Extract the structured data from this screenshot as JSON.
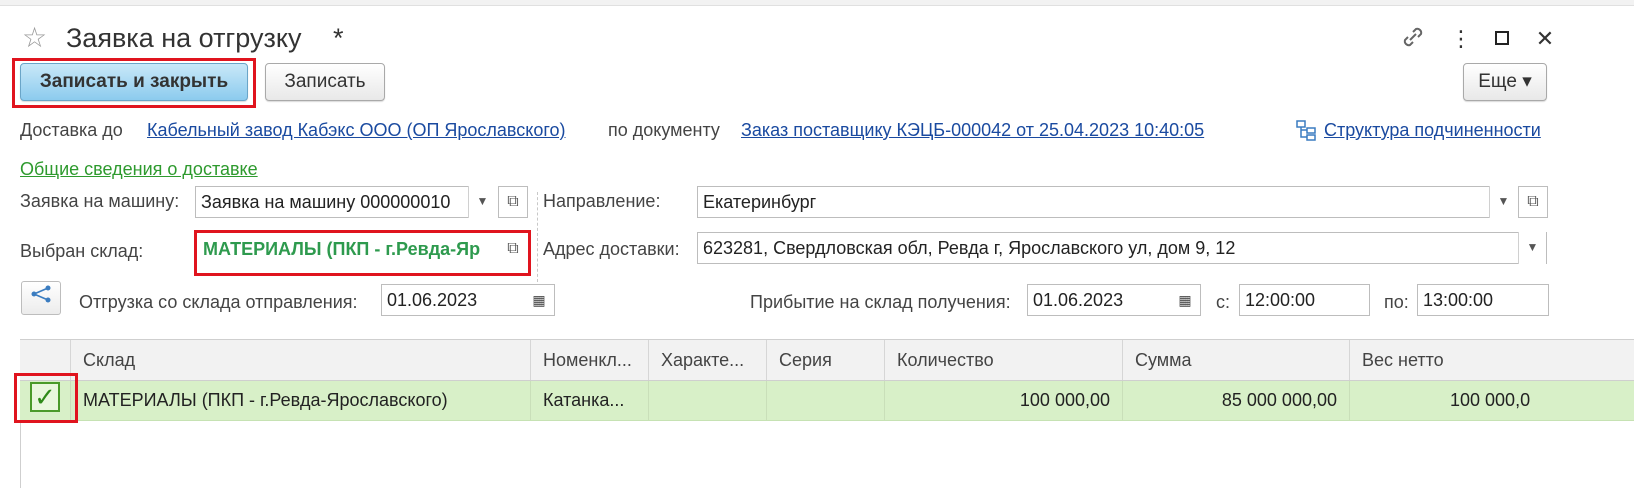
{
  "window": {
    "title": "Заявка на отгрузку",
    "modified_mark": "*",
    "star_icon": "☆",
    "link_icon": "🔗",
    "more_icon": "⋮",
    "maximize_icon": "☐",
    "close_icon": "✕"
  },
  "toolbar": {
    "save_close_label": "Записать и закрыть",
    "save_label": "Записать",
    "more_label": "Еще ▾"
  },
  "delivery": {
    "to_label": "Доставка до",
    "to_value": "Кабельный завод Кабэкс ООО (ОП Ярославского)",
    "doc_label": "по документу",
    "doc_value": "Заказ поставщику КЭЦБ-000042 от 25.04.2023 10:40:05",
    "structure_label": "Структура подчиненности"
  },
  "section_link": "Общие сведения о доставке",
  "form": {
    "car_request_label": "Заявка на машину:",
    "car_request_value": "Заявка на машину 000000010",
    "warehouse_label": "Выбран склад:",
    "warehouse_value": "МАТЕРИАЛЫ (ПКП - г.Ревда-Яр",
    "direction_label": "Направление:",
    "direction_value": "Екатеринбург",
    "address_label": "Адрес доставки:",
    "address_value": "623281, Свердловская обл, Ревда г, Ярославского ул, дом 9, 12",
    "ship_label": "Отгрузка со склада отправления:",
    "ship_date": "01.06.2023",
    "arrive_label": "Прибытие на склад получения:",
    "arrive_date": "01.06.2023",
    "from_label": "с:",
    "from_time": "12:00:00",
    "to_label": "по:",
    "to_time": "13:00:00"
  },
  "table": {
    "columns": [
      "Склад",
      "Номенкл...",
      "Характе...",
      "Серия",
      "Количество",
      "Сумма",
      "Вес нетто"
    ],
    "rows": [
      {
        "checked": "✓",
        "warehouse": "МАТЕРИАЛЫ (ПКП - г.Ревда-Ярославского)",
        "item": "Катанка...",
        "characteristic": "",
        "series": "",
        "quantity": "100 000,00",
        "sum": "85 000 000,00",
        "weight": "100 000,0"
      }
    ]
  },
  "colors": {
    "primary_button": "#8ccbee",
    "link": "#1a4aa0",
    "green_link": "#2e9a2e",
    "selected_row": "#d8f0c8",
    "highlight_box": "#e0141e"
  }
}
